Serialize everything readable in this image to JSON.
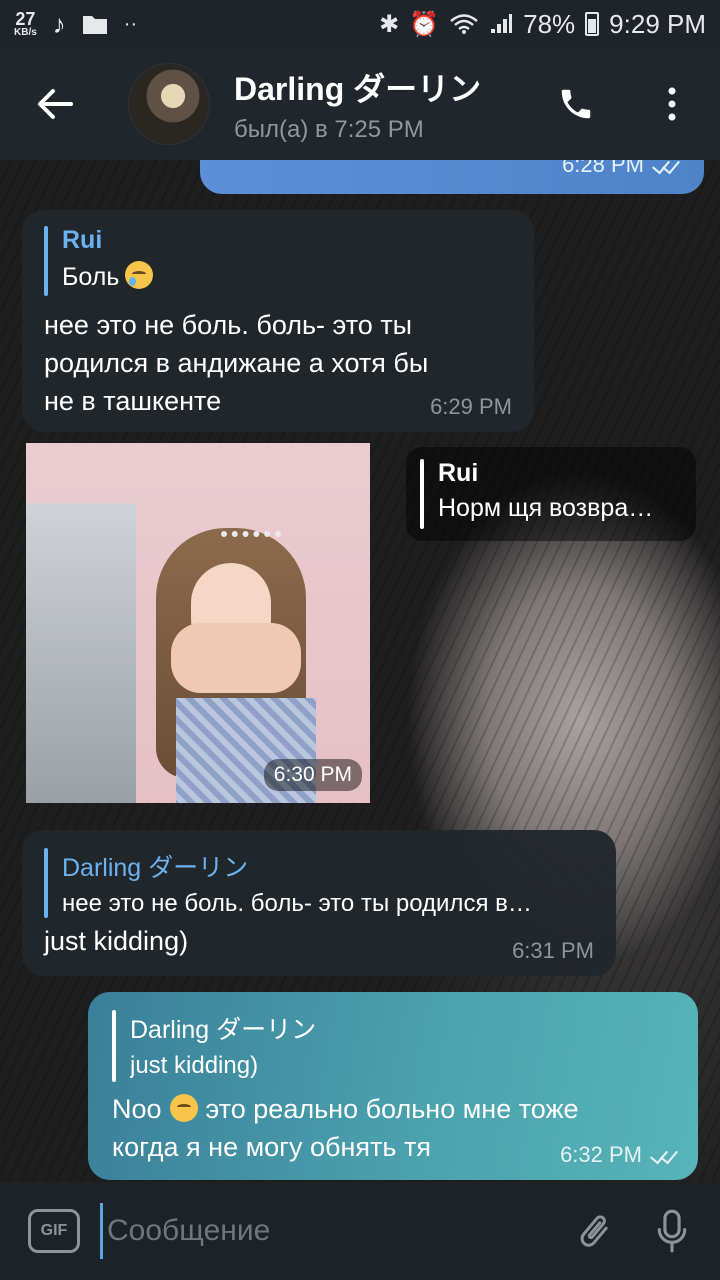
{
  "status_bar": {
    "net_speed": "27",
    "net_unit": "KB/s",
    "battery": "78%",
    "time": "9:29 PM",
    "icons": [
      "music-icon",
      "folder-icon",
      "bluetooth-icon",
      "alarm-icon",
      "wifi-icon",
      "signal-icon",
      "battery-icon"
    ]
  },
  "header": {
    "title": "Darling ダーリン",
    "subtitle": "был(а) в 7:25 PM"
  },
  "messages": {
    "top_out": {
      "time": "6:28 PM"
    },
    "m1": {
      "reply_name": "Rui",
      "reply_text": "Боль",
      "text_l1": "нее это не боль. боль- это ты",
      "text_l2": "родился в андижане а хотя бы",
      "text_l3": "не в ташкенте",
      "time": "6:29 PM"
    },
    "m2": {
      "reply_name": "Rui",
      "reply_text": "Норм щя возвра…",
      "photo_time": "6:30 PM"
    },
    "m3": {
      "reply_name": "Darling ダーリン",
      "reply_text": "нее это не боль. боль- это ты родился в…",
      "text": "just kidding)",
      "time": "6:31 PM"
    },
    "m4": {
      "reply_name": "Darling ダーリン",
      "reply_text": "just kidding)",
      "text_pre": "Noo",
      "text_l1": "это реально больно мне тоже",
      "text_l2": "когда я не могу обнять тя",
      "time": "6:32 PM"
    }
  },
  "input": {
    "gif_label": "GIF",
    "placeholder": "Сообщение"
  },
  "colors": {
    "accent": "#6ab2f2",
    "outgoing_bubble": "#4aa2ad",
    "incoming_bubble": "#21262c"
  }
}
